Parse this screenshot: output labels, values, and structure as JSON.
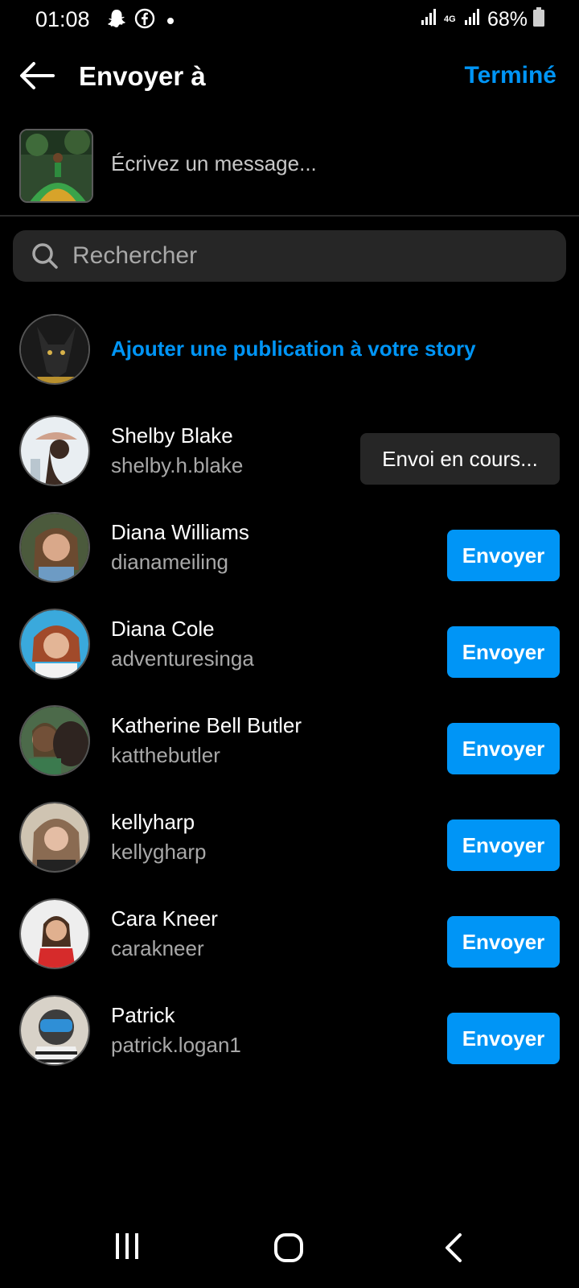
{
  "status_bar": {
    "time": "01:08",
    "network": "4G",
    "battery": "68%"
  },
  "header": {
    "title": "Envoyer à",
    "done_label": "Terminé"
  },
  "message": {
    "placeholder": "Écrivez un message..."
  },
  "search": {
    "placeholder": "Rechercher"
  },
  "story": {
    "label": "Ajouter une publication à votre story"
  },
  "contacts": [
    {
      "name": "Shelby Blake",
      "username": "shelby.h.blake",
      "button": "Envoi en cours...",
      "state": "sending"
    },
    {
      "name": "Diana Williams",
      "username": "dianameiling",
      "button": "Envoyer",
      "state": "idle"
    },
    {
      "name": "Diana Cole",
      "username": "adventuresinga",
      "button": "Envoyer",
      "state": "idle"
    },
    {
      "name": "Katherine Bell Butler",
      "username": "katthebutler",
      "button": "Envoyer",
      "state": "idle"
    },
    {
      "name": "kellyharp",
      "username": "kellygharp",
      "button": "Envoyer",
      "state": "idle"
    },
    {
      "name": "Cara Kneer",
      "username": "carakneer",
      "button": "Envoyer",
      "state": "idle"
    },
    {
      "name": "Patrick",
      "username": "patrick.logan1",
      "button": "Envoyer",
      "state": "idle"
    }
  ],
  "colors": {
    "accent": "#0095f6",
    "background": "#000000",
    "surface": "#262626",
    "secondary_text": "#a8a8a8"
  }
}
